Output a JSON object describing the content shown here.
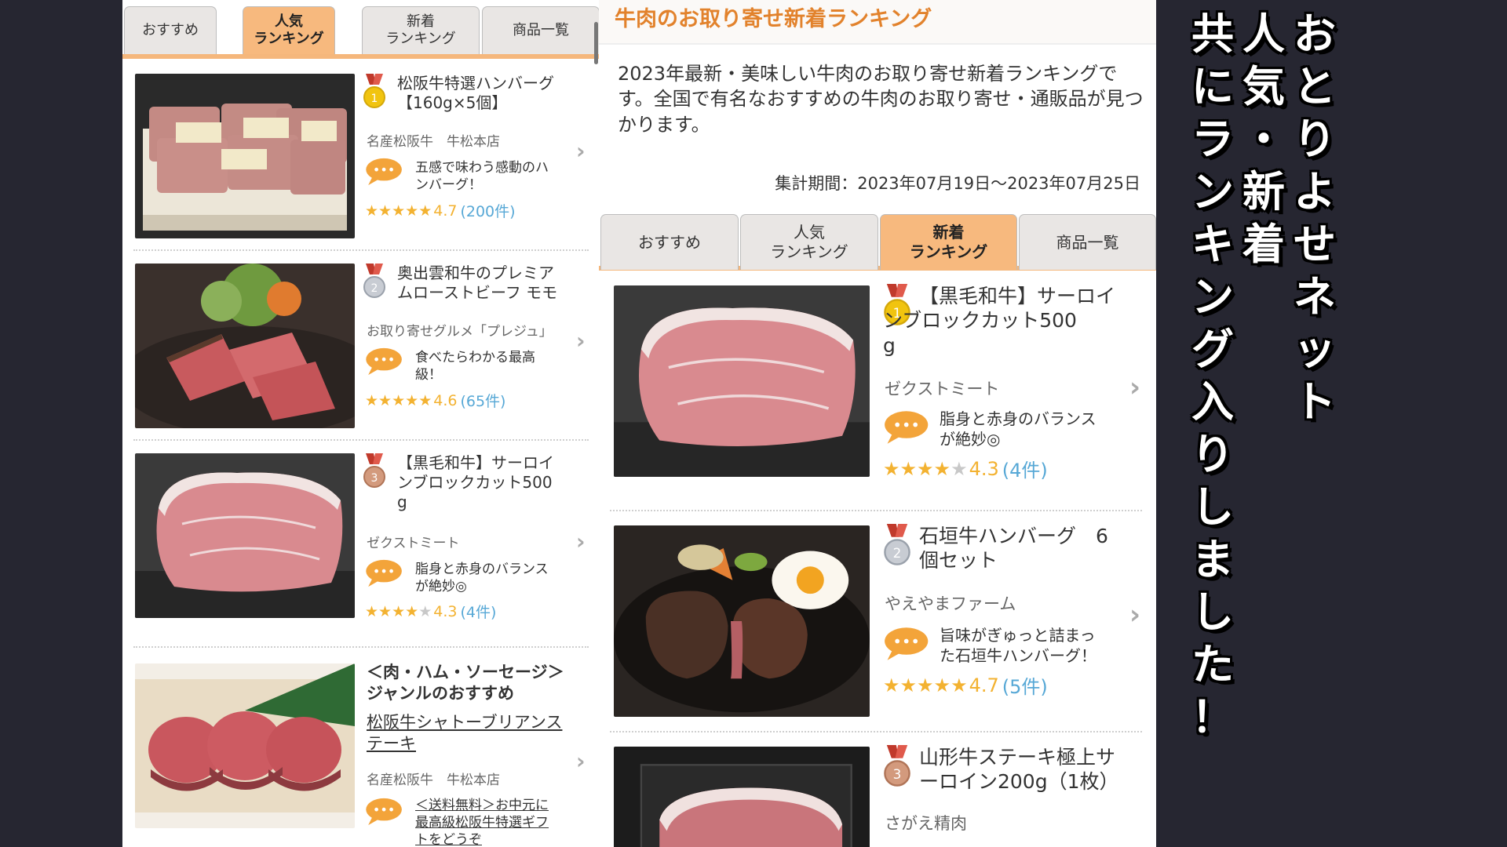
{
  "left_panel": {
    "tabs": [
      {
        "label": "おすすめ",
        "active": false
      },
      {
        "label": "人気\nランキング",
        "active": true
      },
      {
        "label": "新着\nランキング",
        "active": false
      },
      {
        "label": "商品一覧",
        "active": false
      }
    ],
    "items": [
      {
        "rank": 1,
        "name": "松阪牛特選ハンバーグ\n【160g×5個】",
        "shop": "名産松阪牛　牛松本店",
        "comment": "五感で味わう感動のハ\nンバーグ！",
        "stars": 5,
        "score": "4.7",
        "count": "(200件)"
      },
      {
        "rank": 2,
        "name": "奥出雲和牛のプレミア\nムローストビーフ モモ",
        "shop": "お取り寄せグルメ「プレジュ」",
        "comment": "食べたらわかる最高\n級！",
        "stars": 5,
        "score": "4.6",
        "count": "(65件)"
      },
      {
        "rank": 3,
        "name": "【黒毛和牛】サーロイ\nンブロックカット500\ng",
        "shop": "ゼクストミート",
        "comment": "脂身と赤身のバランス\nが絶妙◎",
        "stars": 4,
        "score": "4.3",
        "count": "(4件)"
      }
    ],
    "genre": {
      "title": "＜肉・ハム・ソーセージ＞\nジャンルのおすすめ",
      "name": "松阪牛シャトーブリアンス\nテーキ",
      "shop": "名産松阪牛　牛松本店",
      "comment": "＜送料無料＞お中元に\n最高級松阪牛特選ギフ\nトをどうぞ"
    }
  },
  "right_panel": {
    "title": "牛肉のお取り寄せ新着ランキング",
    "description": "2023年最新・美味しい牛肉のお取り寄せ新着ランキングです。全国で有名なおすすめの牛肉のお取り寄せ・通販品が見つかります。",
    "period": "集計期間：2023年07月19日〜2023年07月25日",
    "tabs": [
      {
        "label": "おすすめ",
        "active": false
      },
      {
        "label": "人気\nランキング",
        "active": false
      },
      {
        "label": "新着\nランキング",
        "active": true
      },
      {
        "label": "商品一覧",
        "active": false
      }
    ],
    "items": [
      {
        "rank": 1,
        "name": "【黒毛和牛】サーロイ\nンブロックカット500\ng",
        "shop": "ゼクストミート",
        "comment": "脂身と赤身のバランス\nが絶妙◎",
        "stars": 4,
        "score": "4.3",
        "count": "(4件)"
      },
      {
        "rank": 2,
        "name": "石垣牛ハンバーグ　6\n個セット",
        "shop": "やえやまファーム",
        "comment": "旨味がぎゅっと詰まっ\nた石垣牛ハンバーグ！",
        "stars": 5,
        "score": "4.7",
        "count": "(5件)"
      },
      {
        "rank": 3,
        "name": "山形牛ステーキ極上サ\nーロイン200g（1枚）",
        "shop": "さがえ精肉"
      }
    ]
  },
  "caption": {
    "columns": [
      "おとりよせネット",
      "人気・新着",
      "共にランキング入りしました！"
    ]
  },
  "colors": {
    "accent_orange": "#f7b97e",
    "title_orange": "#e2822c",
    "star": "#f3b231",
    "count_blue": "#57a8d6",
    "background": "#262631"
  }
}
